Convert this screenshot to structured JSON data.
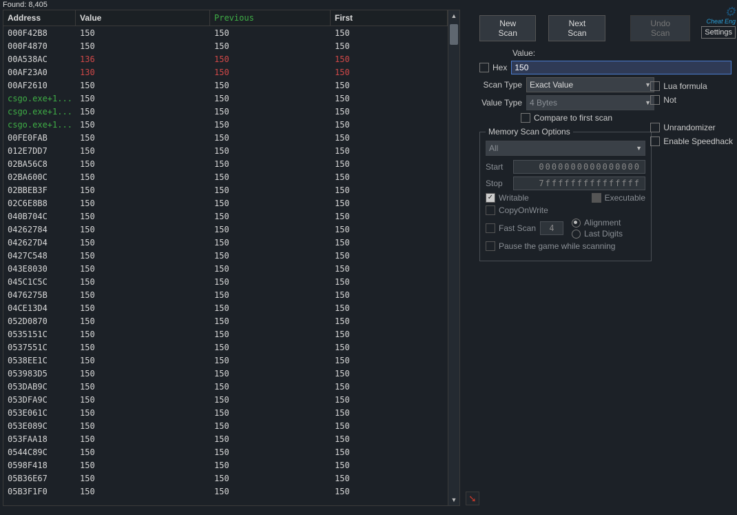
{
  "found_label": "Found:",
  "found_count": "8,405",
  "columns": {
    "address": "Address",
    "value": "Value",
    "previous": "Previous",
    "first": "First"
  },
  "rows": [
    {
      "addr": "000F42B8",
      "val": "150",
      "prev": "150",
      "first": "150",
      "ac": "white",
      "vc": "white",
      "pc": "white",
      "fc": "white"
    },
    {
      "addr": "000F4870",
      "val": "150",
      "prev": "150",
      "first": "150",
      "ac": "white",
      "vc": "white",
      "pc": "white",
      "fc": "white"
    },
    {
      "addr": "00A538AC",
      "val": "136",
      "prev": "150",
      "first": "150",
      "ac": "white",
      "vc": "red",
      "pc": "red",
      "fc": "red"
    },
    {
      "addr": "00AF23A0",
      "val": "130",
      "prev": "150",
      "first": "150",
      "ac": "white",
      "vc": "red",
      "pc": "red",
      "fc": "red"
    },
    {
      "addr": "00AF2610",
      "val": "150",
      "prev": "150",
      "first": "150",
      "ac": "white",
      "vc": "white",
      "pc": "white",
      "fc": "white"
    },
    {
      "addr": "csgo.exe+1...",
      "val": "150",
      "prev": "150",
      "first": "150",
      "ac": "green",
      "vc": "white",
      "pc": "white",
      "fc": "white"
    },
    {
      "addr": "csgo.exe+1...",
      "val": "150",
      "prev": "150",
      "first": "150",
      "ac": "green",
      "vc": "white",
      "pc": "white",
      "fc": "white"
    },
    {
      "addr": "csgo.exe+1...",
      "val": "150",
      "prev": "150",
      "first": "150",
      "ac": "green",
      "vc": "white",
      "pc": "white",
      "fc": "white"
    },
    {
      "addr": "00FE0FAB",
      "val": "150",
      "prev": "150",
      "first": "150",
      "ac": "white",
      "vc": "white",
      "pc": "white",
      "fc": "white"
    },
    {
      "addr": "012E7DD7",
      "val": "150",
      "prev": "150",
      "first": "150",
      "ac": "white",
      "vc": "white",
      "pc": "white",
      "fc": "white"
    },
    {
      "addr": "02BA56C8",
      "val": "150",
      "prev": "150",
      "first": "150",
      "ac": "white",
      "vc": "white",
      "pc": "white",
      "fc": "white"
    },
    {
      "addr": "02BA600C",
      "val": "150",
      "prev": "150",
      "first": "150",
      "ac": "white",
      "vc": "white",
      "pc": "white",
      "fc": "white"
    },
    {
      "addr": "02BBEB3F",
      "val": "150",
      "prev": "150",
      "first": "150",
      "ac": "white",
      "vc": "white",
      "pc": "white",
      "fc": "white"
    },
    {
      "addr": "02C6E8B8",
      "val": "150",
      "prev": "150",
      "first": "150",
      "ac": "white",
      "vc": "white",
      "pc": "white",
      "fc": "white"
    },
    {
      "addr": "040B704C",
      "val": "150",
      "prev": "150",
      "first": "150",
      "ac": "white",
      "vc": "white",
      "pc": "white",
      "fc": "white"
    },
    {
      "addr": "04262784",
      "val": "150",
      "prev": "150",
      "first": "150",
      "ac": "white",
      "vc": "white",
      "pc": "white",
      "fc": "white"
    },
    {
      "addr": "042627D4",
      "val": "150",
      "prev": "150",
      "first": "150",
      "ac": "white",
      "vc": "white",
      "pc": "white",
      "fc": "white"
    },
    {
      "addr": "0427C548",
      "val": "150",
      "prev": "150",
      "first": "150",
      "ac": "white",
      "vc": "white",
      "pc": "white",
      "fc": "white"
    },
    {
      "addr": "043E8030",
      "val": "150",
      "prev": "150",
      "first": "150",
      "ac": "white",
      "vc": "white",
      "pc": "white",
      "fc": "white"
    },
    {
      "addr": "045C1C5C",
      "val": "150",
      "prev": "150",
      "first": "150",
      "ac": "white",
      "vc": "white",
      "pc": "white",
      "fc": "white"
    },
    {
      "addr": "0476275B",
      "val": "150",
      "prev": "150",
      "first": "150",
      "ac": "white",
      "vc": "white",
      "pc": "white",
      "fc": "white"
    },
    {
      "addr": "04CE13D4",
      "val": "150",
      "prev": "150",
      "first": "150",
      "ac": "white",
      "vc": "white",
      "pc": "white",
      "fc": "white"
    },
    {
      "addr": "052D0870",
      "val": "150",
      "prev": "150",
      "first": "150",
      "ac": "white",
      "vc": "white",
      "pc": "white",
      "fc": "white"
    },
    {
      "addr": "0535151C",
      "val": "150",
      "prev": "150",
      "first": "150",
      "ac": "white",
      "vc": "white",
      "pc": "white",
      "fc": "white"
    },
    {
      "addr": "0537551C",
      "val": "150",
      "prev": "150",
      "first": "150",
      "ac": "white",
      "vc": "white",
      "pc": "white",
      "fc": "white"
    },
    {
      "addr": "0538EE1C",
      "val": "150",
      "prev": "150",
      "first": "150",
      "ac": "white",
      "vc": "white",
      "pc": "white",
      "fc": "white"
    },
    {
      "addr": "053983D5",
      "val": "150",
      "prev": "150",
      "first": "150",
      "ac": "white",
      "vc": "white",
      "pc": "white",
      "fc": "white"
    },
    {
      "addr": "053DAB9C",
      "val": "150",
      "prev": "150",
      "first": "150",
      "ac": "white",
      "vc": "white",
      "pc": "white",
      "fc": "white"
    },
    {
      "addr": "053DFA9C",
      "val": "150",
      "prev": "150",
      "first": "150",
      "ac": "white",
      "vc": "white",
      "pc": "white",
      "fc": "white"
    },
    {
      "addr": "053E061C",
      "val": "150",
      "prev": "150",
      "first": "150",
      "ac": "white",
      "vc": "white",
      "pc": "white",
      "fc": "white"
    },
    {
      "addr": "053E089C",
      "val": "150",
      "prev": "150",
      "first": "150",
      "ac": "white",
      "vc": "white",
      "pc": "white",
      "fc": "white"
    },
    {
      "addr": "053FAA18",
      "val": "150",
      "prev": "150",
      "first": "150",
      "ac": "white",
      "vc": "white",
      "pc": "white",
      "fc": "white"
    },
    {
      "addr": "0544C89C",
      "val": "150",
      "prev": "150",
      "first": "150",
      "ac": "white",
      "vc": "white",
      "pc": "white",
      "fc": "white"
    },
    {
      "addr": "0598F418",
      "val": "150",
      "prev": "150",
      "first": "150",
      "ac": "white",
      "vc": "white",
      "pc": "white",
      "fc": "white"
    },
    {
      "addr": "05B36E67",
      "val": "150",
      "prev": "150",
      "first": "150",
      "ac": "white",
      "vc": "white",
      "pc": "white",
      "fc": "white"
    },
    {
      "addr": "05B3F1F0",
      "val": "150",
      "prev": "150",
      "first": "150",
      "ac": "white",
      "vc": "white",
      "pc": "white",
      "fc": "white"
    }
  ],
  "buttons": {
    "new_scan": "New Scan",
    "next_scan": "Next Scan",
    "undo_scan": "Undo Scan",
    "settings": "Settings"
  },
  "value_label": "Value:",
  "hex_label": "Hex",
  "value_input": "150",
  "scan_type_label": "Scan Type",
  "scan_type_value": "Exact Value",
  "value_type_label": "Value Type",
  "value_type_value": "4 Bytes",
  "lua_label": "Lua formula",
  "not_label": "Not",
  "compare_label": "Compare to first scan",
  "unrandomizer_label": "Unrandomizer",
  "speedhack_label": "Enable Speedhack",
  "mem_legend": "Memory Scan Options",
  "mem_all": "All",
  "start_label": "Start",
  "start_value": "0000000000000000",
  "stop_label": "Stop",
  "stop_value": "7fffffffffffffff",
  "writable_label": "Writable",
  "executable_label": "Executable",
  "cow_label": "CopyOnWrite",
  "fastscan_label": "Fast Scan",
  "fastscan_value": "4",
  "alignment_label": "Alignment",
  "lastdigits_label": "Last Digits",
  "pause_label": "Pause the game while scanning",
  "logo_text": "Cheat Eng"
}
